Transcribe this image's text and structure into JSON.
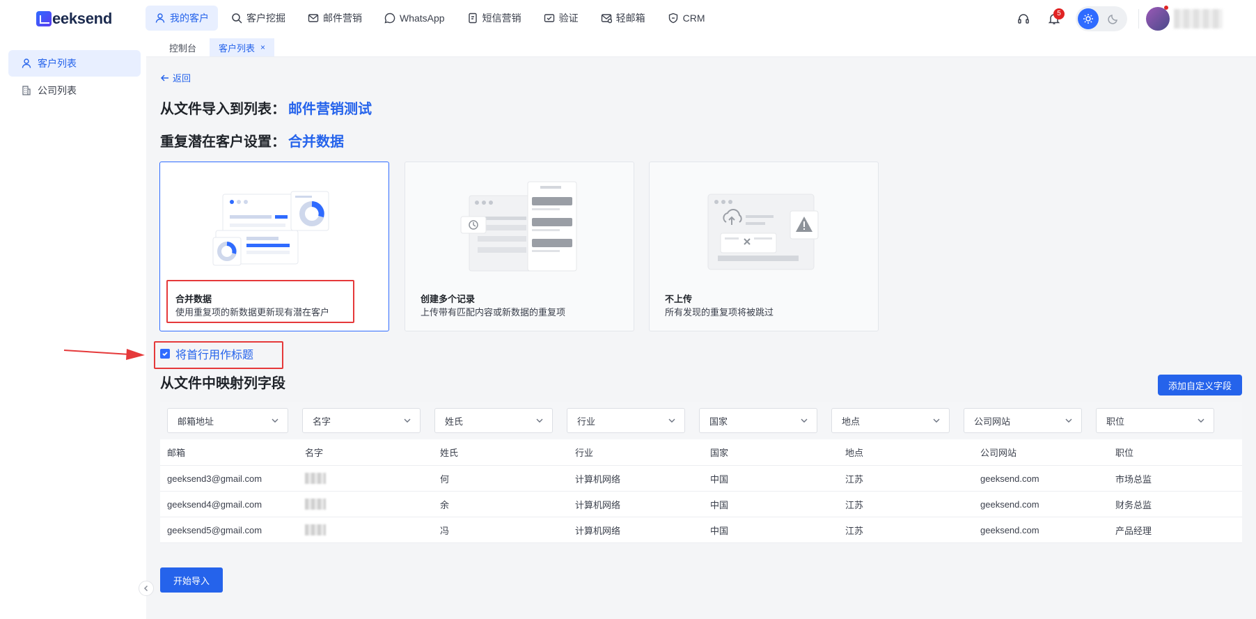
{
  "app": {
    "logo_text": "eeksend"
  },
  "nav": [
    {
      "label": "我的客户",
      "icon": "user-icon",
      "active": true
    },
    {
      "label": "客户挖掘",
      "icon": "search-icon"
    },
    {
      "label": "邮件营销",
      "icon": "mail-icon"
    },
    {
      "label": "WhatsApp",
      "icon": "whatsapp-icon"
    },
    {
      "label": "短信营销",
      "icon": "sms-icon"
    },
    {
      "label": "验证",
      "icon": "verify-icon"
    },
    {
      "label": "轻邮箱",
      "icon": "light-mail-icon"
    },
    {
      "label": "CRM",
      "icon": "crm-icon"
    }
  ],
  "top_right": {
    "notification_count": "5"
  },
  "tabs": [
    {
      "label": "控制台"
    },
    {
      "label": "客户列表",
      "close": "×",
      "active": true
    }
  ],
  "sidebar": [
    {
      "label": "客户列表",
      "icon": "user-icon",
      "active": true
    },
    {
      "label": "公司列表",
      "icon": "building-icon"
    }
  ],
  "main": {
    "back_label": "返回",
    "import_label": "从文件导入到列表：",
    "import_target": "邮件营销测试",
    "dup_label": "重复潜在客户设置：",
    "dup_value": "合并数据",
    "cards": [
      {
        "title": "合并数据",
        "desc": "使用重复项的新数据更新现有潜在客户"
      },
      {
        "title": "创建多个记录",
        "desc": "上传带有匹配内容或新数据的重复项"
      },
      {
        "title": "不上传",
        "desc": "所有发现的重复项将被跳过"
      }
    ],
    "checkbox_label": "将首行用作标题",
    "section_title": "从文件中映射列字段",
    "add_field_button": "添加自定义字段",
    "mapping": [
      "邮箱地址",
      "名字",
      "姓氏",
      "行业",
      "国家",
      "地点",
      "公司网站",
      "职位"
    ],
    "columns": [
      "邮箱",
      "名字",
      "姓氏",
      "行业",
      "国家",
      "地点",
      "公司网站",
      "职位"
    ],
    "rows": [
      [
        "geeksend3@gmail.com",
        "",
        "何",
        "计算机网络",
        "中国",
        "江苏",
        "geeksend.com",
        "市场总监"
      ],
      [
        "geeksend4@gmail.com",
        "",
        "余",
        "计算机网络",
        "中国",
        "江苏",
        "geeksend.com",
        "财务总监"
      ],
      [
        "geeksend5@gmail.com",
        "",
        "冯",
        "计算机网络",
        "中国",
        "江苏",
        "geeksend.com",
        "产品经理"
      ]
    ],
    "start_button": "开始导入"
  }
}
